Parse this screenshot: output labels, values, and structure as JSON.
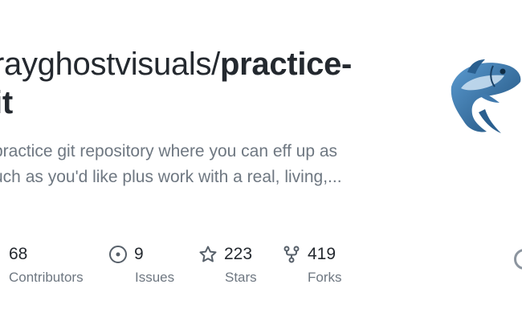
{
  "repo": {
    "owner": "rayghostvisuals/",
    "name_part1": "practice-",
    "name_part2": "it"
  },
  "description": {
    "line1": "practice git repository where you can eff up as",
    "line2": "uch as you'd like plus work with a real, living,..."
  },
  "stats": {
    "contributors": {
      "value": "68",
      "label": "Contributors"
    },
    "issues": {
      "value": "9",
      "label": "Issues",
      "icon": "issue-opened-icon"
    },
    "stars": {
      "value": "223",
      "label": "Stars",
      "icon": "star-icon"
    },
    "forks": {
      "value": "419",
      "label": "Forks",
      "icon": "repo-forked-icon"
    }
  },
  "colors": {
    "title": "#24292f",
    "muted": "#6e7781",
    "icon": "#57606a",
    "logo_dark": "#2a5f8f",
    "logo_light": "#5b9bd1"
  }
}
